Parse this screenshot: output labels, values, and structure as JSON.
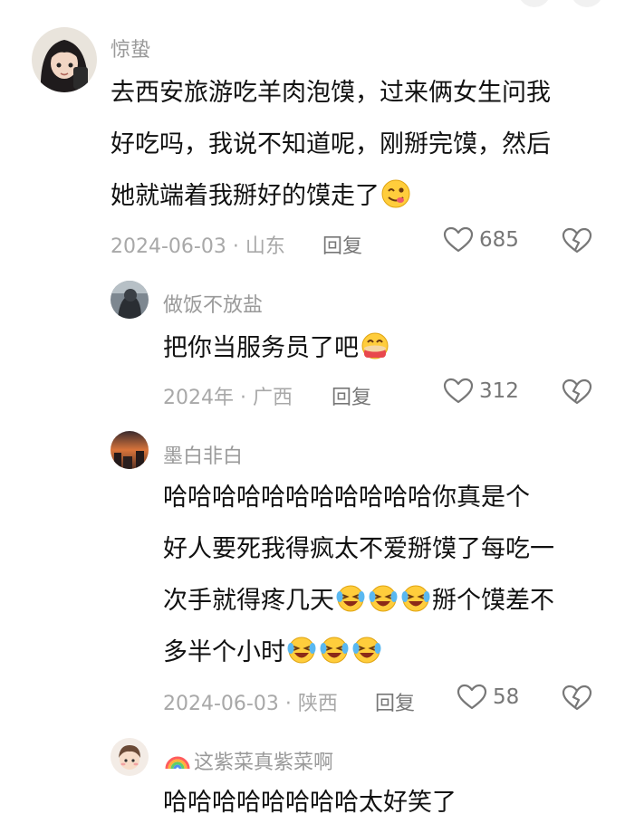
{
  "comments": [
    {
      "username": "惊蛰",
      "lines": [
        "去西安旅游吃羊肉泡馍，过来俩女生问我",
        "好吃吗，我说不知道呢，刚掰完馍，然后",
        "她就端着我掰好的馍走了"
      ],
      "meta": "2024-06-03 · 山东",
      "reply": "回复",
      "likes": "685"
    },
    {
      "username": "做饭不放盐",
      "lines": [
        "把你当服务员了吧"
      ],
      "meta": "2024年 · 广西",
      "reply": "回复",
      "likes": "312"
    },
    {
      "username": "墨白非白",
      "lines": [
        "哈哈哈哈哈哈哈哈哈哈哈你真是个",
        "好人要死我得疯太不爱掰馍了每吃一",
        "次手就得疼几天",
        "掰个馍差不",
        "多半个小时"
      ],
      "meta": "2024-06-03 · 陕西",
      "reply": "回复",
      "likes": "58"
    },
    {
      "username": "这紫菜真紫菜啊",
      "lines": [
        "哈哈哈哈哈哈哈哈太好笑了"
      ]
    }
  ],
  "icons": {
    "like": "heart-outline-icon",
    "dislike": "broken-heart-icon",
    "emoji_yum": "yum-face-emoji",
    "emoji_laugh": "laughing-face-emoji",
    "emoji_rainbow": "rainbow-emoji"
  },
  "colors": {
    "username": "#9a9a9a",
    "text": "#111111",
    "meta": "#a8a8a8",
    "action": "#777777"
  }
}
